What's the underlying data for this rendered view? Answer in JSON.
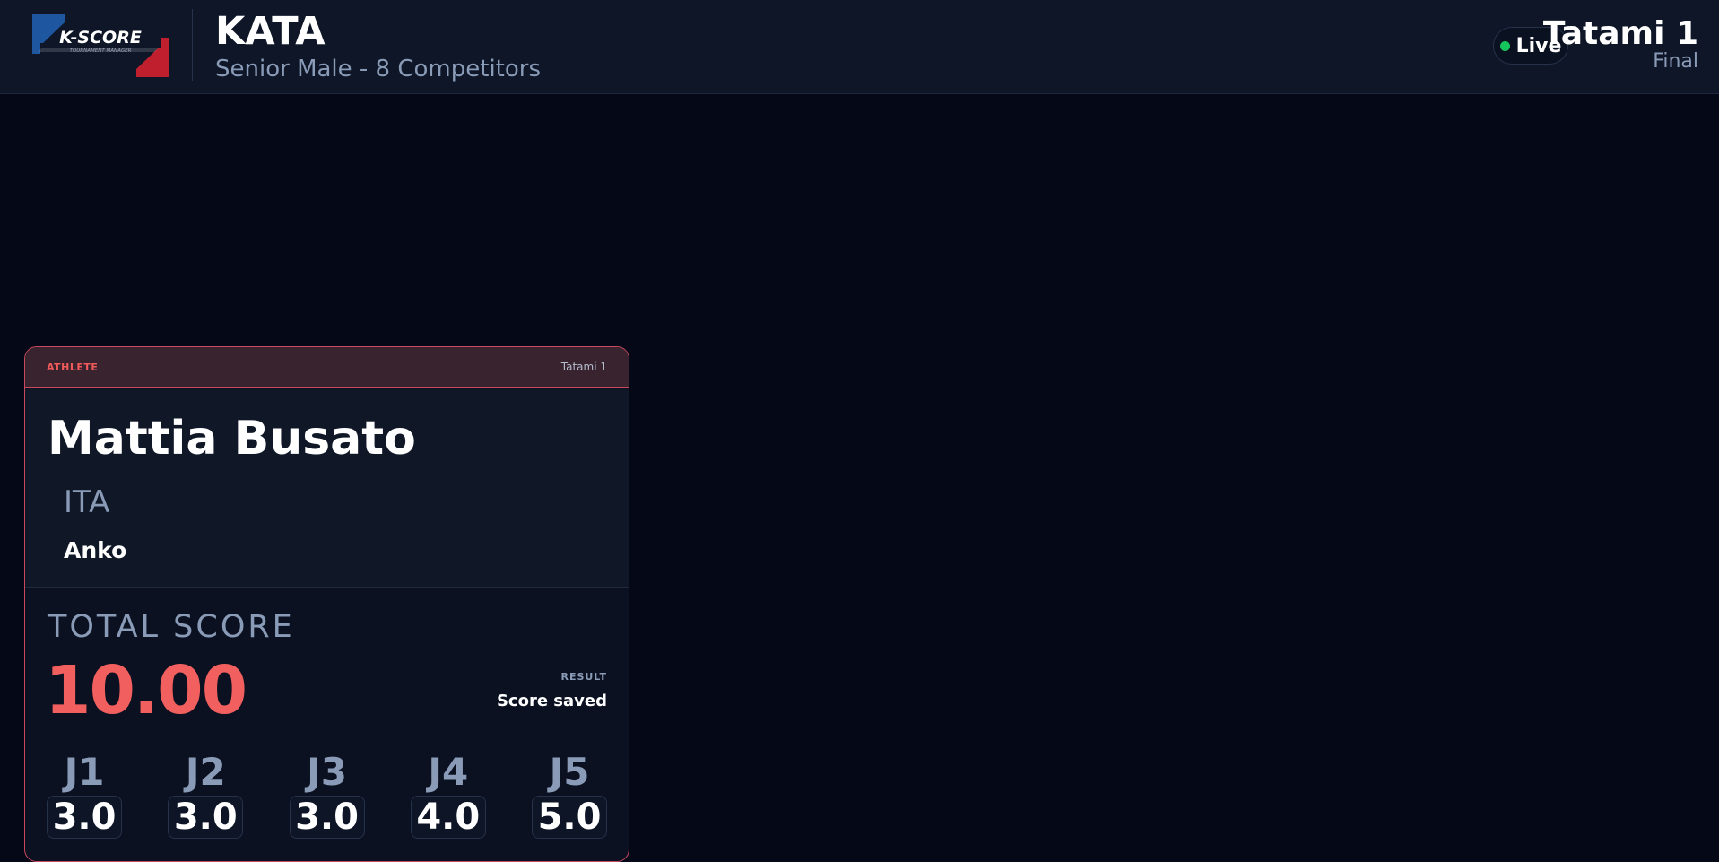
{
  "header": {
    "logo_text": "K-SCORE",
    "logo_subtext": "TOURNAMENT MANAGER",
    "event_title": "KATA",
    "event_subtitle": "Senior Male - 8 Competitors",
    "live_label": "Live",
    "tatami": "Tatami 1",
    "round": "Final"
  },
  "card": {
    "label": "ATHLETE",
    "tatami": "Tatami 1",
    "athlete": {
      "name": "Mattia Busato",
      "country": "ITA",
      "kata": "Anko"
    },
    "total_label": "TOTAL SCORE",
    "total_value": "10.00",
    "result_label": "RESULT",
    "result_value": "Score saved",
    "judges": [
      {
        "name": "J1",
        "score": "3.0"
      },
      {
        "name": "J2",
        "score": "3.0"
      },
      {
        "name": "J3",
        "score": "3.0"
      },
      {
        "name": "J4",
        "score": "4.0"
      },
      {
        "name": "J5",
        "score": "5.0"
      }
    ]
  },
  "colors": {
    "background": "#050917",
    "header_bg": "#0e1627",
    "accent_red": "#f25f5f",
    "card_border": "#c9485d",
    "live_green": "#16c45c",
    "muted_text": "#8a9bb7"
  }
}
